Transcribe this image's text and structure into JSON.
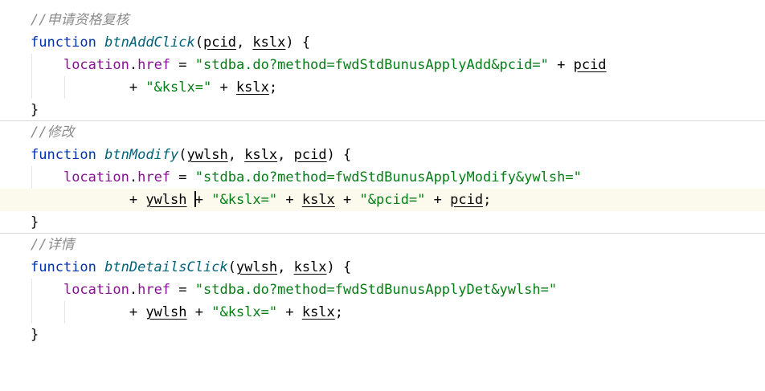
{
  "code": {
    "comment_apply": "//申请资格复核",
    "comment_modify": "//修改",
    "comment_details": "//详情",
    "kw_function": "function",
    "fn_add": "btnAddClick",
    "fn_modify": "btnModify",
    "fn_details": "btnDetailsClick",
    "p_pcid": "pcid",
    "p_kslx": "kslx",
    "p_ywlsh": "ywlsh",
    "obj_location": "location",
    "prop_href": "href",
    "str_add_url": "\"stdba.do?method=fwdStdBunusApplyAdd&pcid=\"",
    "str_modify_url": "\"stdba.do?method=fwdStdBunusApplyModify&ywlsh=\"",
    "str_details_url": "\"stdba.do?method=fwdStdBunusApplyDet&ywlsh=\"",
    "str_kslx": "\"&kslx=\"",
    "str_pcid": "\"&pcid=\"",
    "open_paren": "(",
    "comma": ", ",
    "close_open_brace": ") {",
    "dot": ".",
    "assign": " = ",
    "plus": " + ",
    "semicolon": ";",
    "close_brace": "}",
    "indent_cont": "        + "
  }
}
